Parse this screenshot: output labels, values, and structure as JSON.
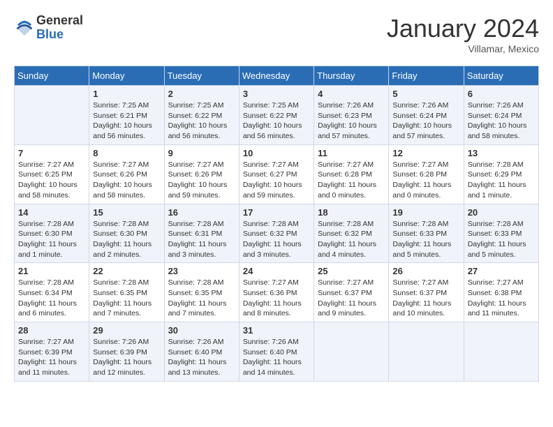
{
  "logo": {
    "general": "General",
    "blue": "Blue"
  },
  "title": "January 2024",
  "location": "Villamar, Mexico",
  "days_of_week": [
    "Sunday",
    "Monday",
    "Tuesday",
    "Wednesday",
    "Thursday",
    "Friday",
    "Saturday"
  ],
  "weeks": [
    [
      {
        "day": "",
        "info": ""
      },
      {
        "day": "1",
        "info": "Sunrise: 7:25 AM\nSunset: 6:21 PM\nDaylight: 10 hours\nand 56 minutes."
      },
      {
        "day": "2",
        "info": "Sunrise: 7:25 AM\nSunset: 6:22 PM\nDaylight: 10 hours\nand 56 minutes."
      },
      {
        "day": "3",
        "info": "Sunrise: 7:25 AM\nSunset: 6:22 PM\nDaylight: 10 hours\nand 56 minutes."
      },
      {
        "day": "4",
        "info": "Sunrise: 7:26 AM\nSunset: 6:23 PM\nDaylight: 10 hours\nand 57 minutes."
      },
      {
        "day": "5",
        "info": "Sunrise: 7:26 AM\nSunset: 6:24 PM\nDaylight: 10 hours\nand 57 minutes."
      },
      {
        "day": "6",
        "info": "Sunrise: 7:26 AM\nSunset: 6:24 PM\nDaylight: 10 hours\nand 58 minutes."
      }
    ],
    [
      {
        "day": "7",
        "info": "Sunrise: 7:27 AM\nSunset: 6:25 PM\nDaylight: 10 hours\nand 58 minutes."
      },
      {
        "day": "8",
        "info": "Sunrise: 7:27 AM\nSunset: 6:26 PM\nDaylight: 10 hours\nand 58 minutes."
      },
      {
        "day": "9",
        "info": "Sunrise: 7:27 AM\nSunset: 6:26 PM\nDaylight: 10 hours\nand 59 minutes."
      },
      {
        "day": "10",
        "info": "Sunrise: 7:27 AM\nSunset: 6:27 PM\nDaylight: 10 hours\nand 59 minutes."
      },
      {
        "day": "11",
        "info": "Sunrise: 7:27 AM\nSunset: 6:28 PM\nDaylight: 11 hours\nand 0 minutes."
      },
      {
        "day": "12",
        "info": "Sunrise: 7:27 AM\nSunset: 6:28 PM\nDaylight: 11 hours\nand 0 minutes."
      },
      {
        "day": "13",
        "info": "Sunrise: 7:28 AM\nSunset: 6:29 PM\nDaylight: 11 hours\nand 1 minute."
      }
    ],
    [
      {
        "day": "14",
        "info": "Sunrise: 7:28 AM\nSunset: 6:30 PM\nDaylight: 11 hours\nand 1 minute."
      },
      {
        "day": "15",
        "info": "Sunrise: 7:28 AM\nSunset: 6:30 PM\nDaylight: 11 hours\nand 2 minutes."
      },
      {
        "day": "16",
        "info": "Sunrise: 7:28 AM\nSunset: 6:31 PM\nDaylight: 11 hours\nand 3 minutes."
      },
      {
        "day": "17",
        "info": "Sunrise: 7:28 AM\nSunset: 6:32 PM\nDaylight: 11 hours\nand 3 minutes."
      },
      {
        "day": "18",
        "info": "Sunrise: 7:28 AM\nSunset: 6:32 PM\nDaylight: 11 hours\nand 4 minutes."
      },
      {
        "day": "19",
        "info": "Sunrise: 7:28 AM\nSunset: 6:33 PM\nDaylight: 11 hours\nand 5 minutes."
      },
      {
        "day": "20",
        "info": "Sunrise: 7:28 AM\nSunset: 6:33 PM\nDaylight: 11 hours\nand 5 minutes."
      }
    ],
    [
      {
        "day": "21",
        "info": "Sunrise: 7:28 AM\nSunset: 6:34 PM\nDaylight: 11 hours\nand 6 minutes."
      },
      {
        "day": "22",
        "info": "Sunrise: 7:28 AM\nSunset: 6:35 PM\nDaylight: 11 hours\nand 7 minutes."
      },
      {
        "day": "23",
        "info": "Sunrise: 7:28 AM\nSunset: 6:35 PM\nDaylight: 11 hours\nand 7 minutes."
      },
      {
        "day": "24",
        "info": "Sunrise: 7:27 AM\nSunset: 6:36 PM\nDaylight: 11 hours\nand 8 minutes."
      },
      {
        "day": "25",
        "info": "Sunrise: 7:27 AM\nSunset: 6:37 PM\nDaylight: 11 hours\nand 9 minutes."
      },
      {
        "day": "26",
        "info": "Sunrise: 7:27 AM\nSunset: 6:37 PM\nDaylight: 11 hours\nand 10 minutes."
      },
      {
        "day": "27",
        "info": "Sunrise: 7:27 AM\nSunset: 6:38 PM\nDaylight: 11 hours\nand 11 minutes."
      }
    ],
    [
      {
        "day": "28",
        "info": "Sunrise: 7:27 AM\nSunset: 6:39 PM\nDaylight: 11 hours\nand 11 minutes."
      },
      {
        "day": "29",
        "info": "Sunrise: 7:26 AM\nSunset: 6:39 PM\nDaylight: 11 hours\nand 12 minutes."
      },
      {
        "day": "30",
        "info": "Sunrise: 7:26 AM\nSunset: 6:40 PM\nDaylight: 11 hours\nand 13 minutes."
      },
      {
        "day": "31",
        "info": "Sunrise: 7:26 AM\nSunset: 6:40 PM\nDaylight: 11 hours\nand 14 minutes."
      },
      {
        "day": "",
        "info": ""
      },
      {
        "day": "",
        "info": ""
      },
      {
        "day": "",
        "info": ""
      }
    ]
  ]
}
